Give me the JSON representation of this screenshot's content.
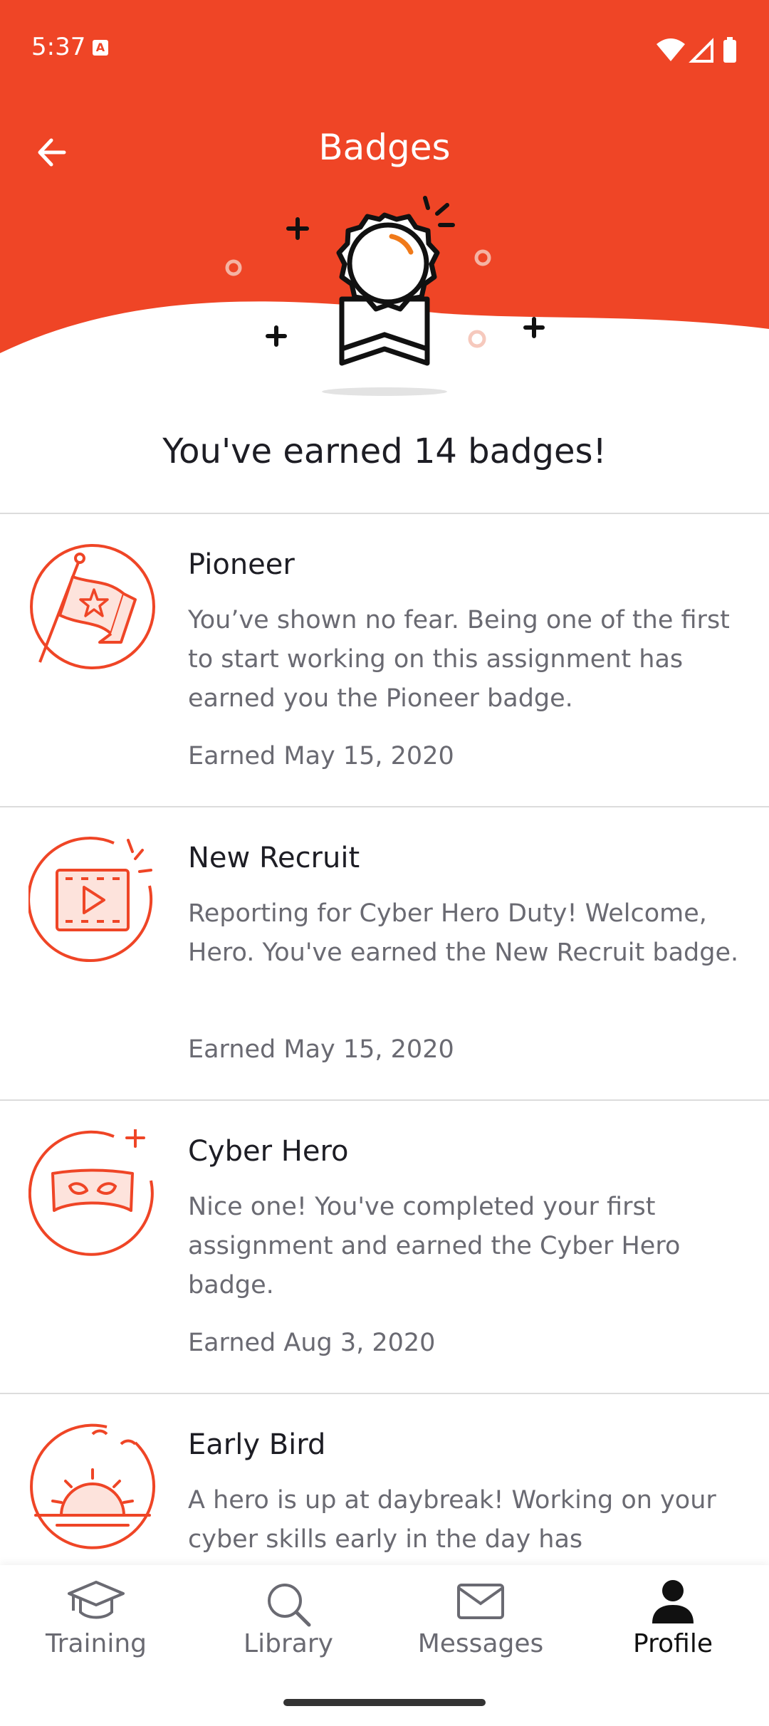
{
  "status_bar": {
    "time": "5:37"
  },
  "header": {
    "title": "Badges"
  },
  "summary": {
    "earned_text": "You've earned 14 badges!"
  },
  "badges": [
    {
      "name": "Pioneer",
      "description": "You’ve shown no fear. Being one of the first to start working on this assignment has earned you the Pioneer badge.",
      "earned": "Earned May 15, 2020",
      "icon": "flag-icon"
    },
    {
      "name": "New Recruit",
      "description": "Reporting for Cyber Hero Duty! Welcome, Hero. You've earned the New Recruit badge.",
      "earned": "Earned May 15, 2020",
      "icon": "video-icon"
    },
    {
      "name": "Cyber Hero",
      "description": "Nice one! You've completed your first assignment and earned the Cyber Hero badge.",
      "earned": "Earned Aug 3, 2020",
      "icon": "mask-icon"
    },
    {
      "name": "Early Bird",
      "description": "A hero is up at daybreak! Working on your cyber skills early in the day has",
      "icon": "sunrise-icon"
    }
  ],
  "nav": {
    "training": "Training",
    "library": "Library",
    "messages": "Messages",
    "profile": "Profile",
    "active": "Profile"
  },
  "colors": {
    "accent": "#EF4526",
    "text": "#1D1D24",
    "muted": "#6A6A72"
  }
}
